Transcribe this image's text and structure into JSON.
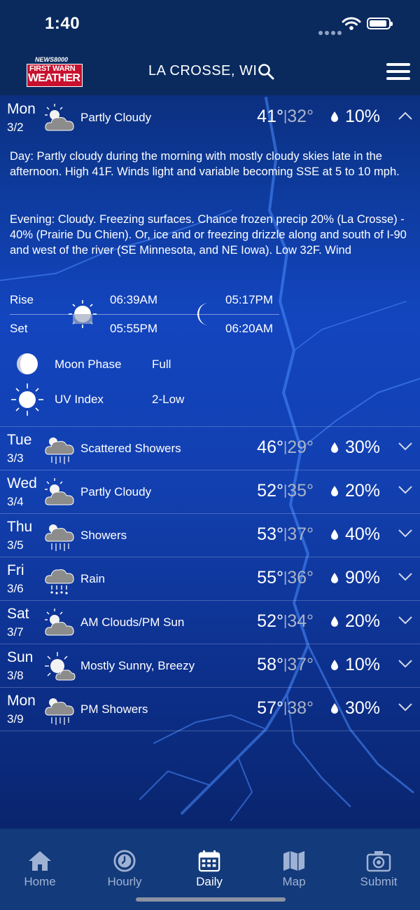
{
  "status_bar": {
    "time": "1:40"
  },
  "header": {
    "logo_top": "NEWS8000",
    "logo_line1": "FIRST WARN",
    "logo_line2": "WEATHER",
    "city": "LA CROSSE, WI"
  },
  "expanded": {
    "day": "Mon",
    "date": "3/2",
    "icon": "partly-cloudy-icon",
    "condition": "Partly Cloudy",
    "high": "41°",
    "low": "32°",
    "precip": "10%",
    "day_label": "Day:",
    "day_text": " Partly cloudy during the morning with mostly cloudy skies late in the afternoon. High 41F. Winds light and variable becoming SSE at 5 to 10 mph.",
    "evening_label": "Evening:",
    "evening_text": " Cloudy. Freezing surfaces. Chance frozen precip 20% (La Crosse) - 40% (Prairie Du Chien). Or, ice and or freezing drizzle along and south of I-90 and west of the river (SE Minnesota, and NE Iowa). Low 32F. Wind",
    "rise_label": "Rise",
    "set_label": "Set",
    "sunrise": "06:39AM",
    "sunset": "05:55PM",
    "moonrise": "05:17PM",
    "moonset": "06:20AM",
    "moon_phase_label": "Moon Phase",
    "moon_phase": "Full",
    "uv_label": "UV Index",
    "uv": "2-Low"
  },
  "days": [
    {
      "day": "Tue",
      "date": "3/3",
      "icon": "scattered-showers-icon",
      "condition": "Scattered Showers",
      "high": "46°",
      "low": "29°",
      "precip": "30%"
    },
    {
      "day": "Wed",
      "date": "3/4",
      "icon": "partly-cloudy-icon",
      "condition": "Partly Cloudy",
      "high": "52°",
      "low": "35°",
      "precip": "20%"
    },
    {
      "day": "Thu",
      "date": "3/5",
      "icon": "showers-icon",
      "condition": "Showers",
      "high": "53°",
      "low": "37°",
      "precip": "40%"
    },
    {
      "day": "Fri",
      "date": "3/6",
      "icon": "rain-icon",
      "condition": "Rain",
      "high": "55°",
      "low": "36°",
      "precip": "90%"
    },
    {
      "day": "Sat",
      "date": "3/7",
      "icon": "partly-cloudy-icon",
      "condition": "AM Clouds/PM Sun",
      "high": "52°",
      "low": "34°",
      "precip": "20%"
    },
    {
      "day": "Sun",
      "date": "3/8",
      "icon": "mostly-sunny-icon",
      "condition": "Mostly Sunny, Breezy",
      "high": "58°",
      "low": "37°",
      "precip": "10%"
    },
    {
      "day": "Mon",
      "date": "3/9",
      "icon": "showers-icon",
      "condition": "PM Showers",
      "high": "57°",
      "low": "38°",
      "precip": "30%"
    }
  ],
  "tabs": [
    {
      "label": "Home",
      "icon": "home-icon"
    },
    {
      "label": "Hourly",
      "icon": "clock-icon"
    },
    {
      "label": "Daily",
      "icon": "calendar-icon"
    },
    {
      "label": "Map",
      "icon": "map-icon"
    },
    {
      "label": "Submit",
      "icon": "camera-icon"
    }
  ]
}
